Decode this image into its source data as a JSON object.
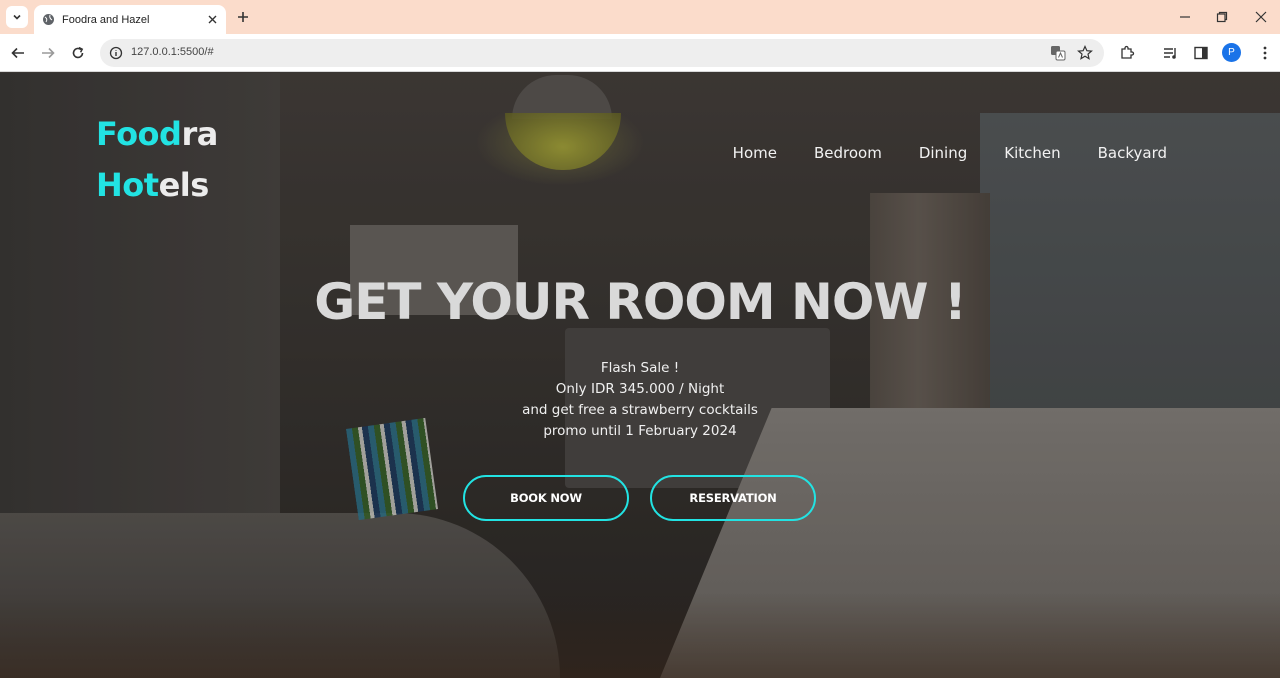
{
  "browser": {
    "tab_title": "Foodra and Hazel",
    "url": "127.0.0.1:5500/#",
    "profile_initial": "P"
  },
  "logo": {
    "line1_accent": "Food",
    "line1_rest": "ra",
    "line2_accent": "Hot",
    "line2_rest": "els",
    "accent_color": "#22e3e3"
  },
  "nav": {
    "items": [
      "Home",
      "Bedroom",
      "Dining",
      "Kitchen",
      "Backyard"
    ]
  },
  "hero": {
    "headline": "GET YOUR ROOM NOW !",
    "promo_lines": [
      "Flash Sale !",
      "Only IDR 345.000 / Night",
      "and get free a strawberry cocktails",
      "promo until 1 February 2024"
    ],
    "book_label": "BOOK NOW",
    "reservation_label": "RESERVATION"
  },
  "icons": {
    "tab_menu": "chevron-down-icon",
    "favicon": "globe-icon",
    "close": "close-icon",
    "new_tab": "plus-icon",
    "back": "back-arrow-icon",
    "forward": "forward-arrow-icon",
    "reload": "reload-icon",
    "info": "info-icon",
    "translate": "translate-icon",
    "bookmark": "star-icon",
    "extensions": "puzzle-icon",
    "media": "media-queue-icon",
    "sidepanel": "side-panel-icon"
  }
}
